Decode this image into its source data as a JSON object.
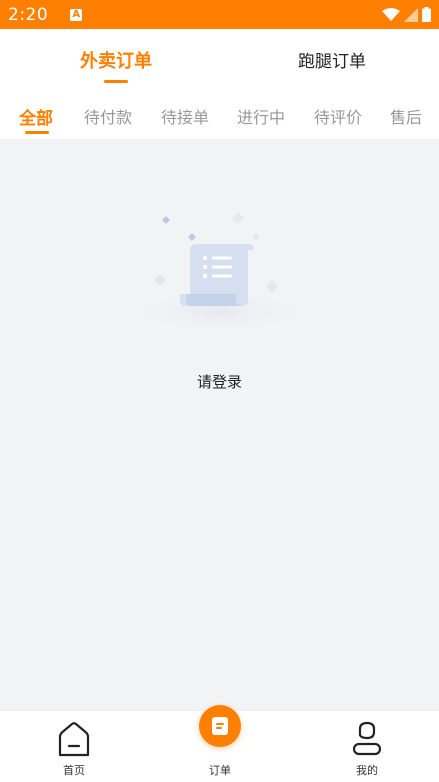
{
  "status_bar": {
    "time": "2:20",
    "app_icon_letter": "A"
  },
  "top_tabs": [
    {
      "label": "外卖订单",
      "active": true
    },
    {
      "label": "跑腿订单",
      "active": false
    }
  ],
  "sub_tabs": [
    {
      "label": "全部",
      "active": true
    },
    {
      "label": "待付款",
      "active": false
    },
    {
      "label": "待接单",
      "active": false
    },
    {
      "label": "进行中",
      "active": false
    },
    {
      "label": "待评价",
      "active": false
    },
    {
      "label": "售后",
      "active": false
    }
  ],
  "empty_state": {
    "message": "请登录",
    "icon": "document-list-icon"
  },
  "bottom_nav": [
    {
      "label": "首页",
      "icon": "home-icon"
    },
    {
      "label": "订单",
      "icon": "order-icon"
    },
    {
      "label": "我的",
      "icon": "user-icon"
    }
  ],
  "colors": {
    "accent": "#ff7f00",
    "background": "#f2f3f5",
    "inactive_text": "#999999"
  }
}
